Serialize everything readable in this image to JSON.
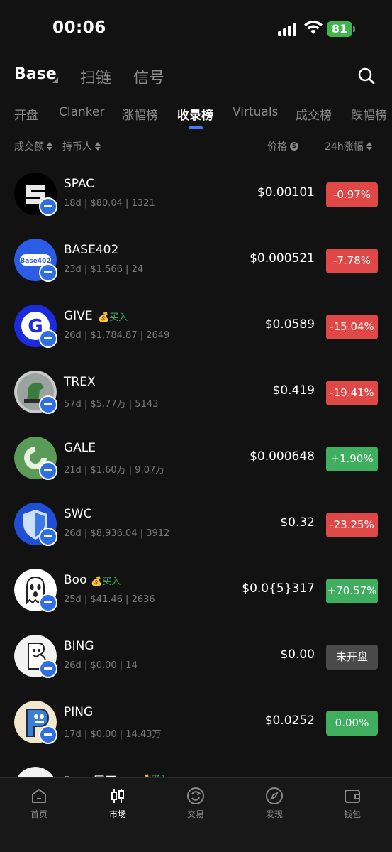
{
  "status": {
    "time": "00:06",
    "battery": "81"
  },
  "header": {
    "chain": "Base",
    "items": [
      "扫链",
      "信号"
    ]
  },
  "tabs": [
    "开盘",
    "Clanker",
    "涨幅榜",
    "收录榜",
    "Virtuals",
    "成交榜",
    "跌幅榜"
  ],
  "active_tab": "收录榜",
  "sort": {
    "volume": "成交额",
    "holders": "持币人",
    "price": "价格",
    "change": "24h涨幅"
  },
  "tokens": [
    {
      "symbol": "SPAC",
      "buy": "",
      "meta": "18d | $80.04 | 1321",
      "price": "$0.00101",
      "change": "-0.97%",
      "dir": "down",
      "avatar": "spac"
    },
    {
      "symbol": "BASE402",
      "buy": "",
      "meta": "23d | $1.566 | 24",
      "price": "$0.000521",
      "change": "-7.78%",
      "dir": "down",
      "avatar": "base402"
    },
    {
      "symbol": "GIVE",
      "buy": "买入",
      "meta": "26d | $1,784.87 | 2649",
      "price": "$0.0589",
      "change": "-15.04%",
      "dir": "down",
      "avatar": "give"
    },
    {
      "symbol": "TREX",
      "buy": "",
      "meta": "57d | $5.77万 | 5143",
      "price": "$0.419",
      "change": "-19.41%",
      "dir": "down",
      "avatar": "trex"
    },
    {
      "symbol": "GALE",
      "buy": "",
      "meta": "21d | $1.60万 | 9.07万",
      "price": "$0.000648",
      "change": "+1.90%",
      "dir": "up",
      "avatar": "gale"
    },
    {
      "symbol": "SWC",
      "buy": "",
      "meta": "26d | $8,936.04 | 3912",
      "price": "$0.32",
      "change": "-23.25%",
      "dir": "down",
      "avatar": "swc"
    },
    {
      "symbol": "Boo",
      "buy": "买入",
      "meta": "25d | $41.46 | 2636",
      "price": "$0.0{5}317",
      "change": "+70.57%",
      "dir": "up",
      "avatar": "boo"
    },
    {
      "symbol": "BING",
      "buy": "",
      "meta": "26d | $0.00 | 14",
      "price": "$0.00",
      "change": "未开盘",
      "dir": "neutral",
      "avatar": "bing"
    },
    {
      "symbol": "PING",
      "buy": "",
      "meta": "17d | $0.00 | 14.43万",
      "price": "$0.0252",
      "change": "0.00%",
      "dir": "up",
      "avatar": "ping"
    },
    {
      "symbol": "Base屠王",
      "buy": "买入",
      "meta": "",
      "price": "",
      "change": "",
      "dir": "up",
      "avatar": "last"
    }
  ],
  "nav": [
    "首页",
    "市场",
    "交易",
    "发现",
    "钱包"
  ],
  "nav_active": "市场",
  "colors": {
    "accent": "#4a78f0",
    "down": "#e04848",
    "up": "#3fae5f",
    "buy": "#3fb55f"
  }
}
